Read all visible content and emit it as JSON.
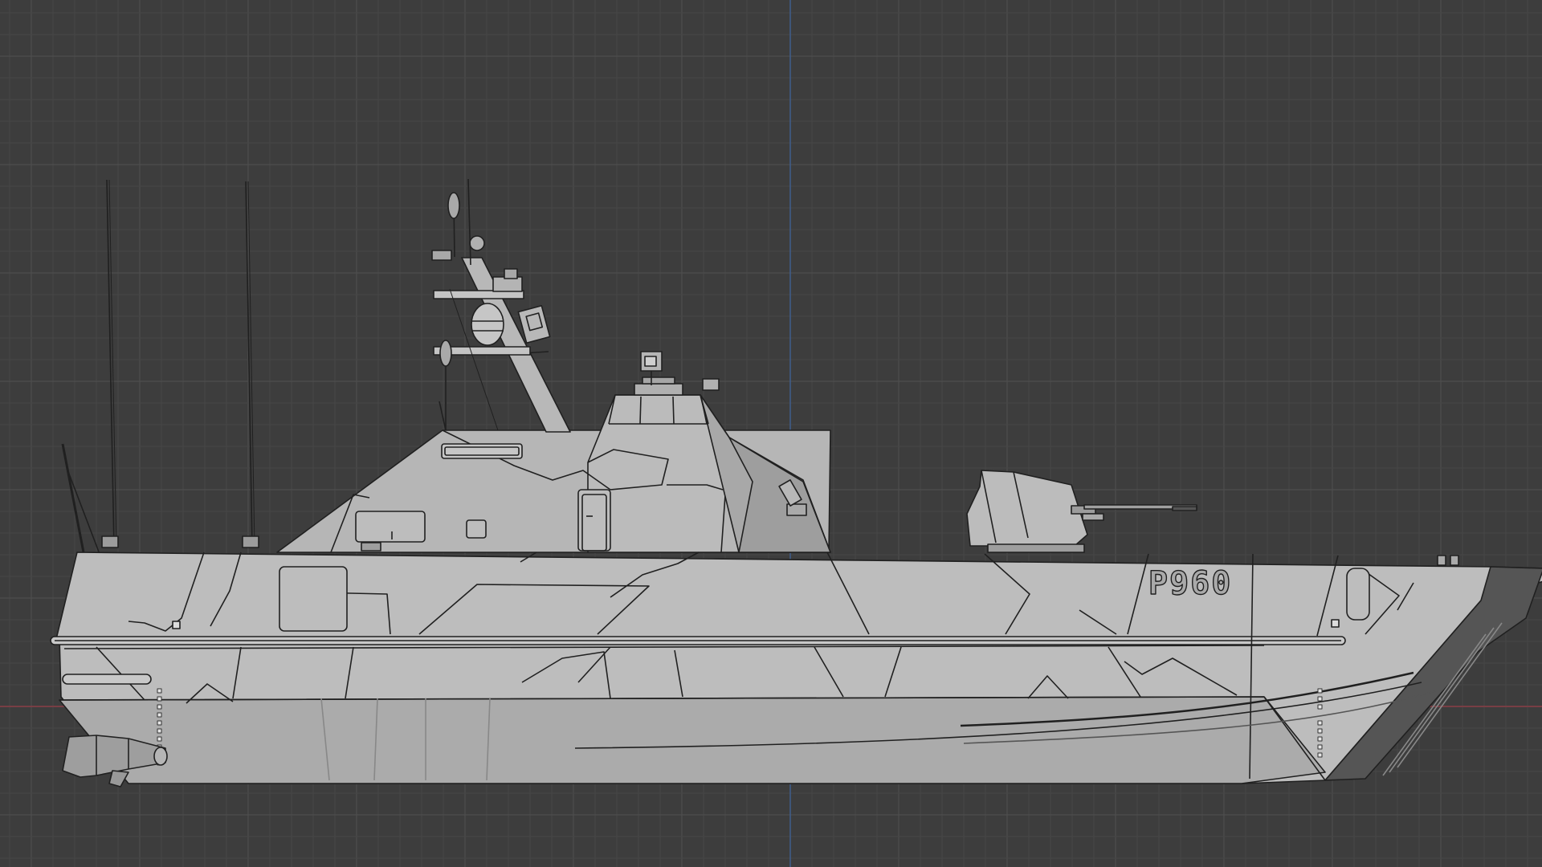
{
  "viewport": {
    "background": "#3d3d3d",
    "grid_minor_color": "#464646",
    "grid_major_color": "#4e4e4e",
    "axis_x_color": "#8a3d45",
    "axis_z_color": "#3f5d8c"
  },
  "model": {
    "hull_number": "P960",
    "hull_fill": "#b6b6b6",
    "hull_fill_light": "#c4c4c4",
    "hull_fill_dark": "#9c9c9c",
    "edge_color": "#202020",
    "number_fill": "#a9a9a9"
  }
}
